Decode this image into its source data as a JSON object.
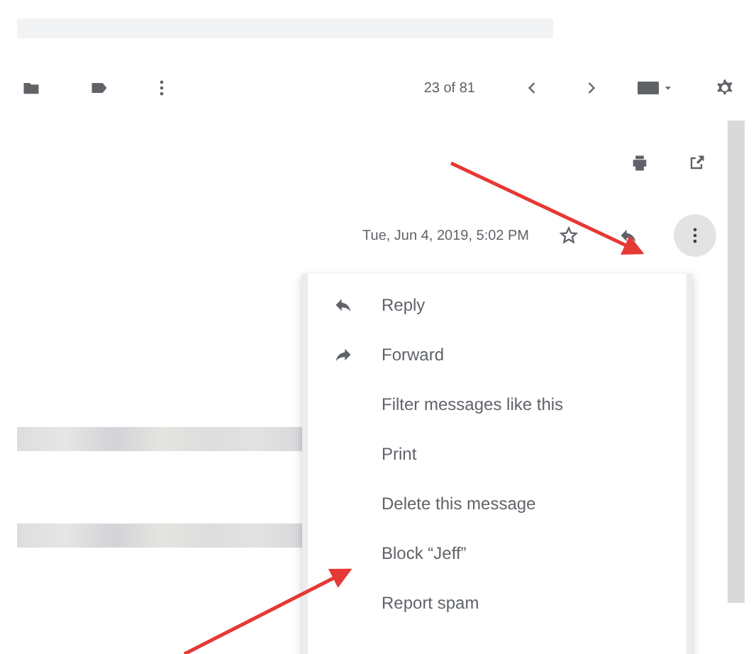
{
  "toolbar": {
    "counter": "23 of 81"
  },
  "message": {
    "date": "Tue, Jun 4, 2019, 5:02 PM"
  },
  "menu": {
    "items": [
      {
        "label": "Reply",
        "kind": "reply"
      },
      {
        "label": "Forward",
        "kind": "forward"
      },
      {
        "label": "Filter messages like this",
        "kind": "plain"
      },
      {
        "label": "Print",
        "kind": "plain"
      },
      {
        "label": "Delete this message",
        "kind": "plain"
      },
      {
        "label": "Block “Jeff”",
        "kind": "plain"
      },
      {
        "label": "Report spam",
        "kind": "plain"
      }
    ]
  }
}
